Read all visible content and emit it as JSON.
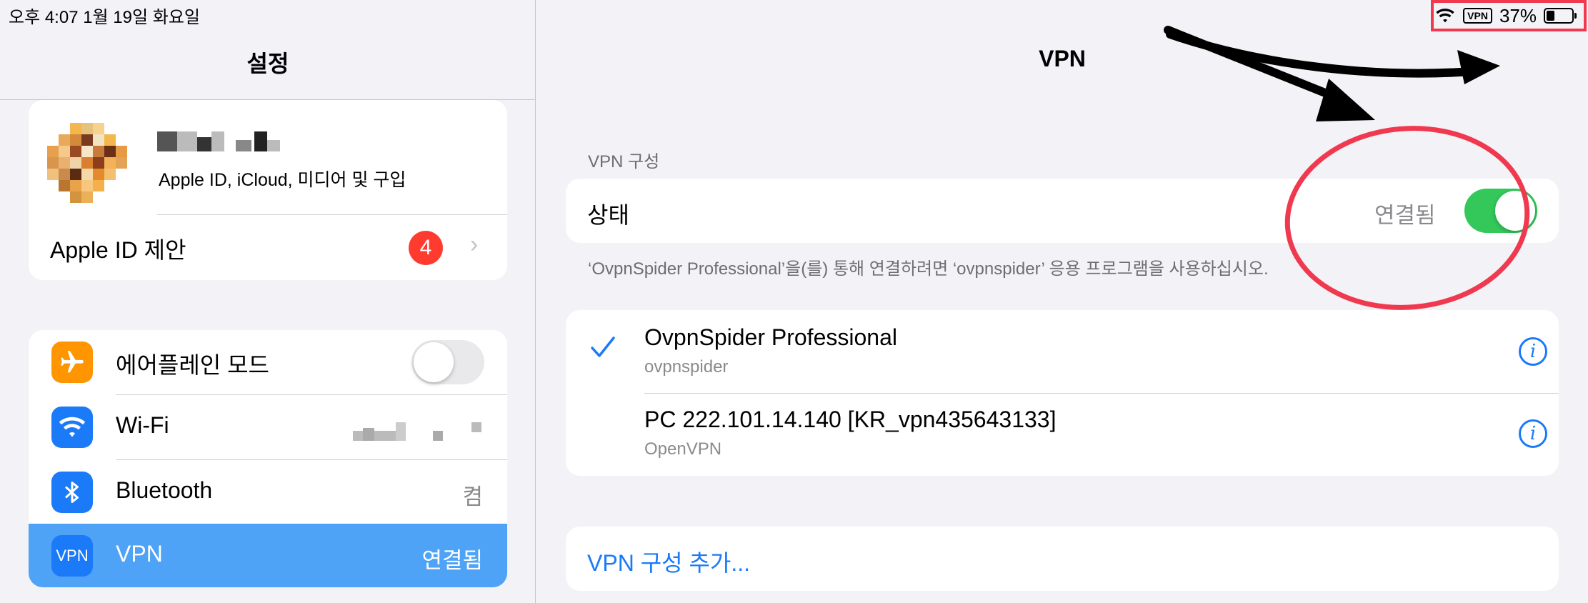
{
  "status_bar": {
    "time_date": "오후 4:07   1월 19일 화요일",
    "vpn_badge": "VPN",
    "battery_percent": "37%",
    "battery_level": 0.37
  },
  "left": {
    "title": "설정",
    "profile": {
      "subtitle": "Apple ID, iCloud, 미디어 및 구입"
    },
    "apple_id_suggestions": {
      "label": "Apple ID 제안",
      "badge": "4"
    },
    "rows": [
      {
        "label": "에어플레인 모드",
        "icon": "airplane-icon",
        "icon_color": "#ff9500",
        "toggle": false
      },
      {
        "label": "Wi-Fi",
        "icon": "wifi-icon",
        "icon_color": "#1a7af8"
      },
      {
        "label": "Bluetooth",
        "icon": "bluetooth-icon",
        "icon_color": "#1a7af8",
        "value": "켬"
      },
      {
        "label": "VPN",
        "icon": "vpn-icon",
        "icon_text": "VPN",
        "icon_color": "#1a7af8",
        "value": "연결됨",
        "selected": true
      }
    ]
  },
  "right": {
    "title": "VPN",
    "section_header": "VPN 구성",
    "status": {
      "label": "상태",
      "value": "연결됨",
      "toggle": true
    },
    "footnote": "‘OvpnSpider Professional’을(를) 통해 연결하려면 ‘ovpnspider’ 응용 프로그램을 사용하십시오.",
    "configs": [
      {
        "name": "OvpnSpider Professional",
        "type": "ovpnspider",
        "checked": true
      },
      {
        "name": "PC 222.101.14.140 [KR_vpn435643133]",
        "type": "OpenVPN",
        "checked": false
      }
    ],
    "add_config": "VPN 구성 추가..."
  },
  "colors": {
    "accent": "#1a7af8",
    "toggle_on": "#34c759",
    "selected_row": "#4ea3f6",
    "annotation_red": "#f0394f"
  }
}
